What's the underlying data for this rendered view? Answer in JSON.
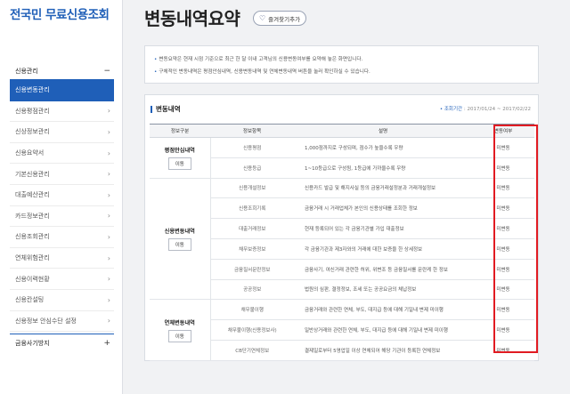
{
  "sidebar": {
    "title": "전국민 무료신용조회",
    "section": {
      "label": "신용관리",
      "sign": "−"
    },
    "items": [
      {
        "label": "신용변동관리",
        "active": true
      },
      {
        "label": "신용평점관리"
      },
      {
        "label": "신상정보관리"
      },
      {
        "label": "신용요약서"
      },
      {
        "label": "기본신용관리"
      },
      {
        "label": "대출예산관리"
      },
      {
        "label": "카드정보관리"
      },
      {
        "label": "신용조회관리"
      },
      {
        "label": "연체위험관리"
      },
      {
        "label": "신용이력현황"
      },
      {
        "label": "신용칸설팅"
      },
      {
        "label": "신용정보 안심수단 설정"
      }
    ],
    "bottom": {
      "label": "금융사기방지",
      "sign": "+"
    },
    "chevron": "›"
  },
  "page": {
    "title": "변동내역요약",
    "fav_label": "즐겨찾기추가",
    "fav_icon": "♡"
  },
  "notice": {
    "lines": [
      "변동요약은 현재 시점 기준으로 최근 한 달 이내 고객님의 신용변동여부를 요약해 놓은 화면입니다.",
      "구체적인 변동내역은 평점안심내역, 신용변동내역 및 연체변동내역 버튼을 눌러 확인하실 수 있습니다."
    ]
  },
  "section": {
    "title": "변동내역",
    "period_label": "조회기간",
    "period_value": "2017/01/24 ~ 2017/02/22"
  },
  "table": {
    "headers": [
      "정보구분",
      "정보항목",
      "설명",
      "변동여부"
    ],
    "groups": [
      {
        "name": "평점안심내역",
        "button": "이동",
        "rows": [
          {
            "item": "신용평점",
            "desc": "1,000점까지로 구성되며, 점수가 높을수록 우량",
            "status": "미변동"
          },
          {
            "item": "신용등급",
            "desc": "1~10등급으로 구성됨, 1등급에 가까울수록 우량",
            "status": "미변동"
          }
        ]
      },
      {
        "name": "신용변동내역",
        "button": "이동",
        "rows": [
          {
            "item": "신용개설정보",
            "desc": "신용카드 발급 및 해지사실 등의 금융거래설정분과 거래개설정보",
            "status": "미변동"
          },
          {
            "item": "신용조회기록",
            "desc": "금융거래 시 거래업체가 본인의 신용상태를 조회한 정보",
            "status": "미변동"
          },
          {
            "item": "대출거래정보",
            "desc": "현재 등록되어 있는 각 금융기관별 가입 대출정보",
            "status": "미변동"
          },
          {
            "item": "채무보증정보",
            "desc": "각 금융기관과 제3자와의 거래에 대한 보증을 한 상세정보",
            "status": "미변동"
          },
          {
            "item": "금융질서문란정보",
            "desc": "금융사기, 여신거래 관련한 허위, 위변조 등 금융질서를 문란케 한 정보",
            "status": "미변동"
          },
          {
            "item": "공공정보",
            "desc": "법원의 심판, 결정정보, 조세 또는 공공요금의 체납정보",
            "status": "미변동"
          }
        ]
      },
      {
        "name": "연체변동내역",
        "button": "이동",
        "rows": [
          {
            "item": "채무불이행",
            "desc": "금융거래와 관련한 연체, 부도, 대지급 등에 대해 기일내 변제 미이행",
            "status": "미변동"
          },
          {
            "item": "채무불이행(신용정보사)",
            "desc": "일반상거래와 관련한 연체, 부도, 대지급 등에 대해 기일내 변제 미이행",
            "status": "미변동"
          },
          {
            "item": "CB단기연체정보",
            "desc": "결제일로부터 5영업일 이상 연체되어 해당 기관이 등록한 연체정보",
            "status": "미변동"
          }
        ]
      }
    ]
  },
  "colors": {
    "brand_blue": "#1f5fb8",
    "highlight_red": "#e11b22"
  }
}
